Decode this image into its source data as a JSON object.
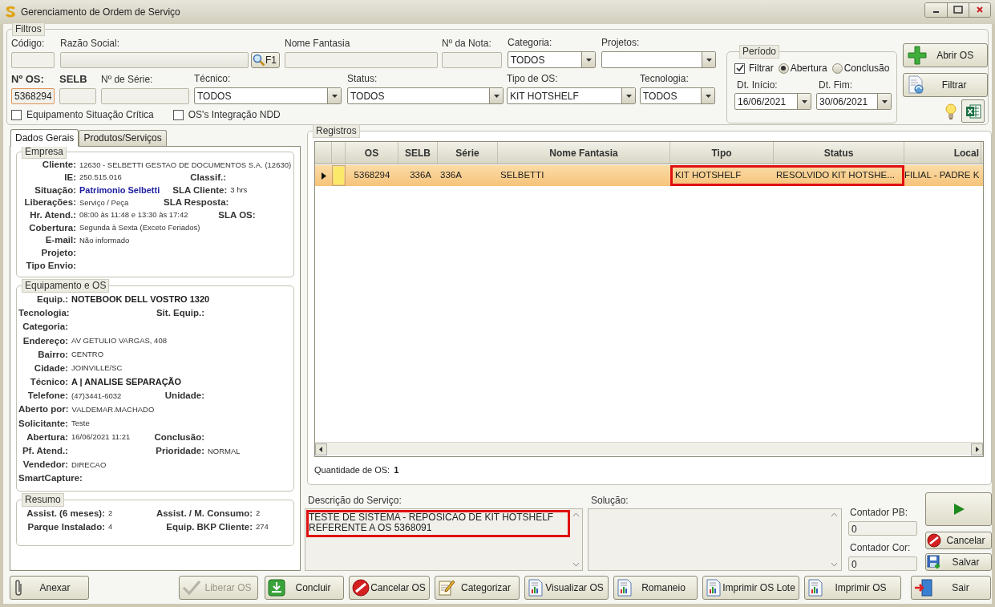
{
  "window": {
    "title": "Gerenciamento de Ordem de Serviço"
  },
  "filters": {
    "title": "Filtros",
    "row_1": [
      {
        "kind": "text",
        "label": "Código:"
      },
      {
        "kind": "lookup",
        "label": "Razão Social:",
        "button": "F1"
      },
      {
        "kind": "text",
        "label": "Nome Fantasia"
      },
      {
        "kind": "text",
        "label": "Nº da Nota:"
      },
      {
        "kind": "select",
        "label": "Categoria:",
        "value": "TODOS"
      },
      {
        "kind": "select",
        "label": "Projetos:"
      }
    ],
    "row_2": [
      {
        "kind": "key",
        "label": "Nº OS:",
        "value": "5368294",
        "focused": true
      },
      {
        "kind": "key",
        "label": "SELB",
        "focused": false
      },
      {
        "kind": "text",
        "label": "Nº de Série:",
        "focused": false
      },
      {
        "kind": "select",
        "label": "Técnico:",
        "value": "TODOS",
        "focused": false
      },
      {
        "kind": "select",
        "label": "Status:",
        "value": "TODOS",
        "focused": false
      },
      {
        "kind": "select",
        "label": "Tipo de OS:",
        "value": "KIT HOTSHELF",
        "focused": false
      },
      {
        "kind": "select",
        "label": "Tecnologia:",
        "value": "TODOS",
        "focused": false
      }
    ],
    "checkboxes": [
      {
        "label": "Equipamento Situação Crítica",
        "checked": false
      },
      {
        "label": "OS's Integração NDD",
        "checked": false
      }
    ]
  },
  "period": {
    "title": "Período",
    "filter": {
      "label": "Filtrar",
      "checked": true
    },
    "options": [
      {
        "label": "Abertura",
        "selected": true
      },
      {
        "label": "Conclusão",
        "selected": false
      }
    ],
    "start": {
      "label": "Dt. Início:",
      "value": "16/06/2021"
    },
    "end": {
      "label": "Dt. Fim:",
      "value": "30/06/2021"
    }
  },
  "actions": [
    "Abrir OS",
    "Filtrar"
  ],
  "tabs": [
    {
      "label": "Dados Gerais",
      "selected": true
    },
    {
      "label": "Produtos/Serviços",
      "selected": false
    }
  ],
  "empresa": {
    "title": "Empresa",
    "rows": [
      [
        {
          "label": "Cliente:",
          "value": "12630 - SELBETTI GESTAO DE DOCUMENTOS S.A. (12630)"
        }
      ],
      [
        {
          "label": "IE:",
          "value": "250.515.016"
        },
        {
          "label": "Classif.:"
        }
      ],
      [
        {
          "label": "Situação:",
          "value": "Patrimonio Selbetti",
          "kind": "link"
        },
        {
          "label": "SLA Cliente:",
          "value": "3 hrs"
        }
      ],
      [
        {
          "label": "Liberações:",
          "value": "Serviço / Peça"
        },
        {
          "label": "SLA Resposta:"
        }
      ],
      [
        {
          "label": "Hr. Atend.:",
          "value": "08:00 às 11:48 e 13:30 às 17:42"
        },
        {
          "label": "SLA OS:"
        }
      ],
      [
        {
          "label": "Cobertura:",
          "value": "Segunda à Sexta (Exceto Feriados)"
        }
      ],
      [
        {
          "label": "E-mail:",
          "value": "Não informado"
        }
      ],
      [
        {
          "label": "Projeto:"
        }
      ],
      [
        {
          "label": "Tipo Envio:"
        }
      ]
    ]
  },
  "equipamento": {
    "title": "Equipamento e OS",
    "rows": [
      [
        {
          "label": "Equip.:",
          "value": "NOTEBOOK DELL VOSTRO 1320",
          "kind": "bold"
        }
      ],
      [
        {
          "label": "Tecnologia:"
        },
        {
          "label": "Sit. Equip.:"
        }
      ],
      [
        {
          "label": "Categoria:"
        }
      ],
      [
        {
          "label": "Endereço:",
          "value": "AV GETULIO VARGAS, 408"
        }
      ],
      [
        {
          "label": "Bairro:",
          "value": "CENTRO"
        }
      ],
      [
        {
          "label": "Cidade:",
          "value": "JOINVILLE/SC"
        }
      ],
      [
        {
          "label": "Técnico:",
          "value": "A | ANALISE SEPARAÇÃO",
          "kind": "bold"
        }
      ],
      [
        {
          "label": "Telefone:",
          "value": "(47)3441-6032"
        },
        {
          "label": "Unidade:"
        }
      ],
      [
        {
          "label": "Aberto por:",
          "value": "VALDEMAR.MACHADO"
        }
      ],
      [
        {
          "label": "Solicitante:",
          "value": "Teste"
        }
      ],
      [
        {
          "label": "Abertura:",
          "value": "16/06/2021 11:21"
        },
        {
          "label": "Conclusão:"
        }
      ],
      [
        {
          "label": "Pf. Atend.:"
        },
        {
          "label": "Prioridade:",
          "value": "NORMAL"
        }
      ],
      [
        {
          "label": "Vendedor:",
          "value": "DIRECAO"
        }
      ],
      [
        {
          "label": "SmartCapture:"
        }
      ]
    ]
  },
  "resumo": {
    "title": "Resumo",
    "rows": [
      [
        {
          "label": "Assist. (6 meses):",
          "value": "2"
        },
        {
          "label": "Assist. / M. Consumo:",
          "value": "2"
        }
      ],
      [
        {
          "label": "Parque Instalado:",
          "value": "4"
        },
        {
          "label": "Equip. BKP Cliente:",
          "value": "274"
        }
      ]
    ]
  },
  "registros": {
    "title": "Registros",
    "columns": [
      "OS",
      "SELB",
      "Série",
      "Nome Fantasia",
      "Tipo",
      "Status",
      "Local"
    ],
    "rows": [
      {
        "selected": true,
        "color": "#fbe96a",
        "cells": [
          {
            "text": "5368294",
            "highlighted": false
          },
          {
            "text": "336A",
            "highlighted": false
          },
          {
            "text": "336A",
            "highlighted": false
          },
          {
            "text": "SELBETTI",
            "highlighted": false
          },
          {
            "text": "KIT HOTSHELF",
            "highlighted": true
          },
          {
            "text": "RESOLVIDO KIT HOTSHE...",
            "highlighted": true
          },
          {
            "text": "FILIAL - PADRE K",
            "highlighted": false
          }
        ]
      }
    ],
    "count": {
      "label": "Quantidade de OS:",
      "value": "1"
    }
  },
  "description": {
    "label": "Descrição do Serviço:",
    "lines": [
      "TESTE DE SISTEMA - REPOSICAO DE KIT HOTSHELF",
      "REFERENTE A OS 5368091"
    ],
    "highlighted": true
  },
  "solution": {
    "label": "Solução:"
  },
  "counters": [
    {
      "label": "Contador PB:",
      "value": "0"
    },
    {
      "label": "Contador Cor:",
      "value": "0"
    }
  ],
  "side_buttons": [
    "Cancelar",
    "Salvar"
  ],
  "bottom_buttons": [
    {
      "label": "Anexar",
      "disabled": false
    },
    {
      "label": "Liberar OS",
      "disabled": true
    },
    {
      "label": "Concluir",
      "disabled": false
    },
    {
      "label": "Cancelar OS",
      "disabled": false
    },
    {
      "label": "Categorizar",
      "disabled": false
    },
    {
      "label": "Visualizar OS",
      "disabled": false
    },
    {
      "label": "Romaneio",
      "disabled": false
    },
    {
      "label": "Imprimir OS Lote",
      "disabled": false
    },
    {
      "label": "Imprimir OS",
      "disabled": false
    },
    {
      "label": "Sair",
      "disabled": false
    }
  ]
}
